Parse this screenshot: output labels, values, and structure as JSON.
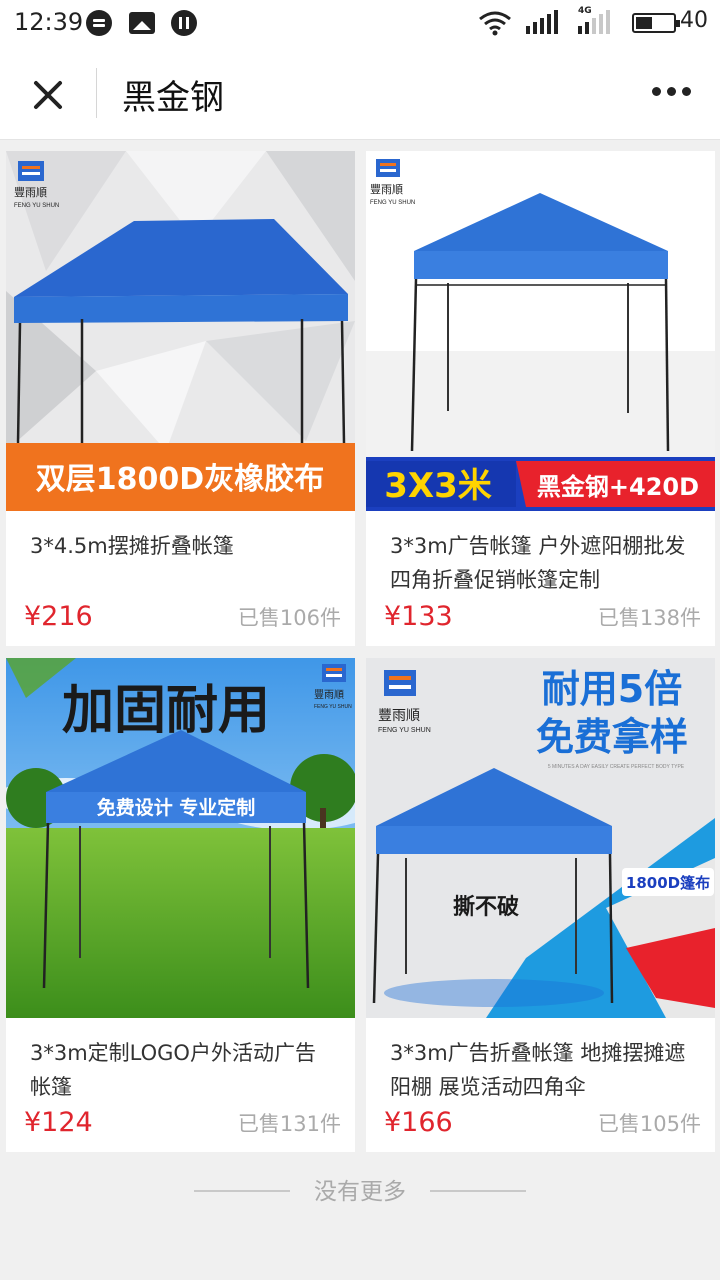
{
  "status_bar": {
    "time": "12:39",
    "network": "4G",
    "battery": "40",
    "icons": [
      "chat-bubble-icon",
      "image-icon",
      "pause-circle-icon",
      "wifi-icon",
      "signal-icon",
      "battery-icon"
    ]
  },
  "nav": {
    "title": "黑金钢",
    "close_icon": "close-icon",
    "more_icon": "more-dots-icon"
  },
  "products": [
    {
      "title": "3*4.5m摆摊折叠帐篷",
      "price": "¥216",
      "sold": "已售106件",
      "image": {
        "brand": "豐雨順",
        "brand_en": "FENG YU SHUN",
        "banner": "双层1800D灰橡胶布"
      }
    },
    {
      "title": "3*3m广告帐篷 户外遮阳棚批发 四角折叠促销帐篷定制",
      "price": "¥133",
      "sold": "已售138件",
      "image": {
        "brand": "豐雨順",
        "brand_en": "FENG YU SHUN",
        "banner_left": "3X3米",
        "banner_right": "黑金钢+420D"
      }
    },
    {
      "title": "3*3m定制LOGO户外活动广告帐篷",
      "price": "¥124",
      "sold": "已售131件",
      "image": {
        "brand": "豐雨順",
        "brand_en": "FENG YU SHUN",
        "headline": "加固耐用",
        "tent_text": "免费设计  专业定制"
      }
    },
    {
      "title": "3*3m广告折叠帐篷 地摊摆摊遮阳棚 展览活动四角伞",
      "price": "¥166",
      "sold": "已售105件",
      "image": {
        "brand": "豐雨順",
        "brand_en": "FENG YU SHUN",
        "line1": "耐用5倍",
        "line2": "免费拿样",
        "small": "5 MINUTES A DAY EASILY CREATE PERFECT BODY TYPE",
        "tag": "1800D篷布",
        "center": "撕不破"
      }
    }
  ],
  "footer": {
    "text": "没有更多"
  },
  "colors": {
    "price": "#e0252d",
    "tent_blue": "#2f73d6",
    "orange_banner": "#f0731e",
    "red_banner": "#e8222c"
  }
}
